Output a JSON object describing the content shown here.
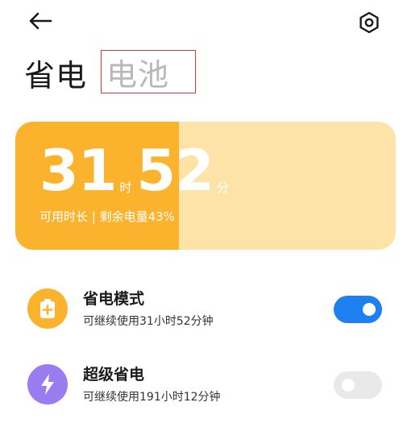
{
  "header": {
    "back_icon": "arrow-left-icon",
    "settings_icon": "settings-hexagon-icon"
  },
  "tabs": [
    {
      "label": "省电",
      "active": true
    },
    {
      "label": "电池",
      "active": false
    }
  ],
  "battery": {
    "hours": "31",
    "hours_unit": "时",
    "minutes": "52",
    "minutes_unit": "分",
    "subtitle": "可用时长 | 剩余电量43%",
    "level_percent": 43,
    "fill_color": "#fbb22d",
    "track_color": "#fde3a7"
  },
  "modes": [
    {
      "title": "省电模式",
      "subtitle": "可继续使用31小时52分钟",
      "icon": "battery-plus-icon",
      "icon_color": "#fbb22d",
      "enabled": true
    },
    {
      "title": "超级省电",
      "subtitle": "可继续使用191小时12分钟",
      "icon": "lightning-bolt-icon",
      "icon_color": "#9b7cf0",
      "enabled": false
    }
  ],
  "colors": {
    "toggle_on": "#1e7ff0",
    "toggle_off": "#e9e9e9",
    "tab_highlight_border": "#d93838"
  }
}
